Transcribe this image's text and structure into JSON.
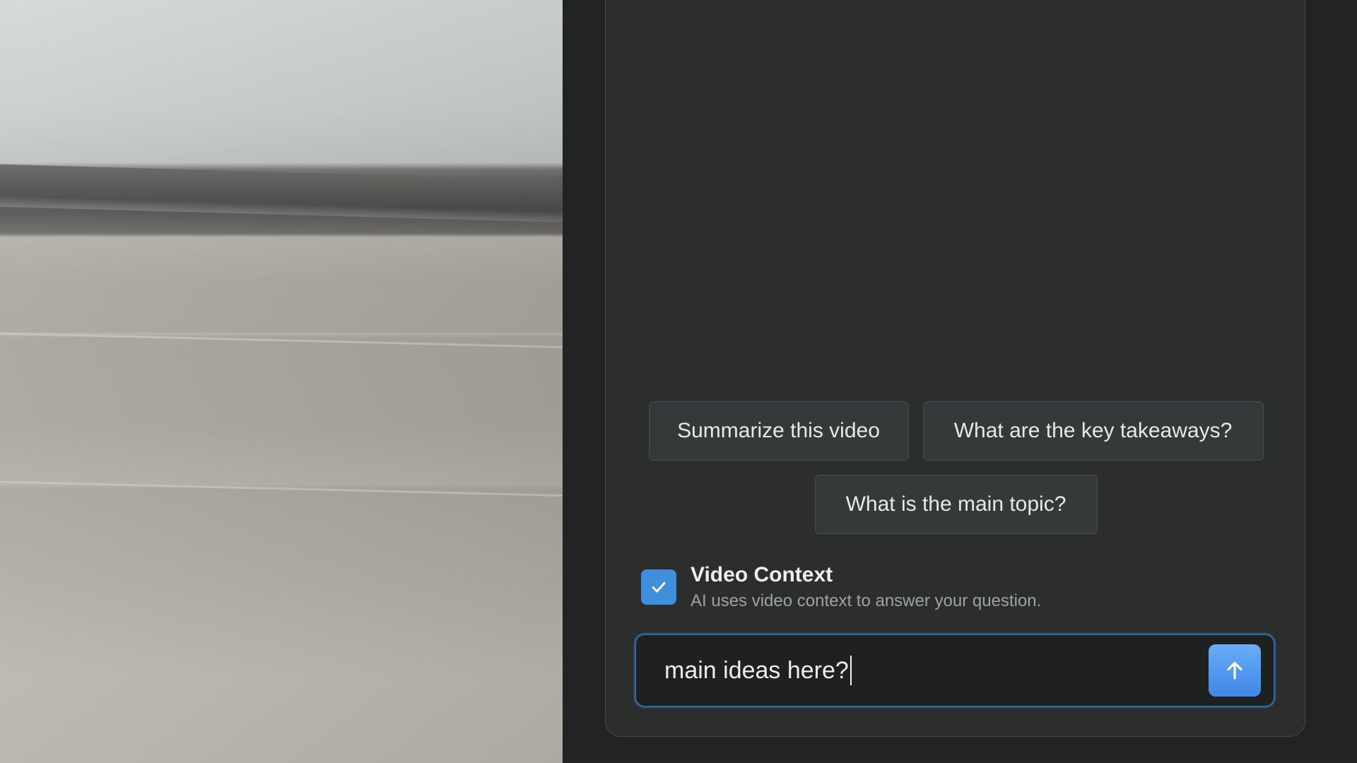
{
  "suggestions": [
    {
      "label": "Summarize this video"
    },
    {
      "label": "What are the key takeaways?"
    },
    {
      "label": "What is the main topic?"
    }
  ],
  "video_context": {
    "checked": true,
    "title": "Video Context",
    "description": "AI uses video context to answer your question."
  },
  "chat_input": {
    "value": "main ideas here?"
  },
  "icons": {
    "send": "arrow-up-icon",
    "checkbox": "checkmark-icon"
  },
  "colors": {
    "accent": "#3f8fdc",
    "panel_bg": "#2c2e2e",
    "input_border": "#2f6aa8"
  }
}
